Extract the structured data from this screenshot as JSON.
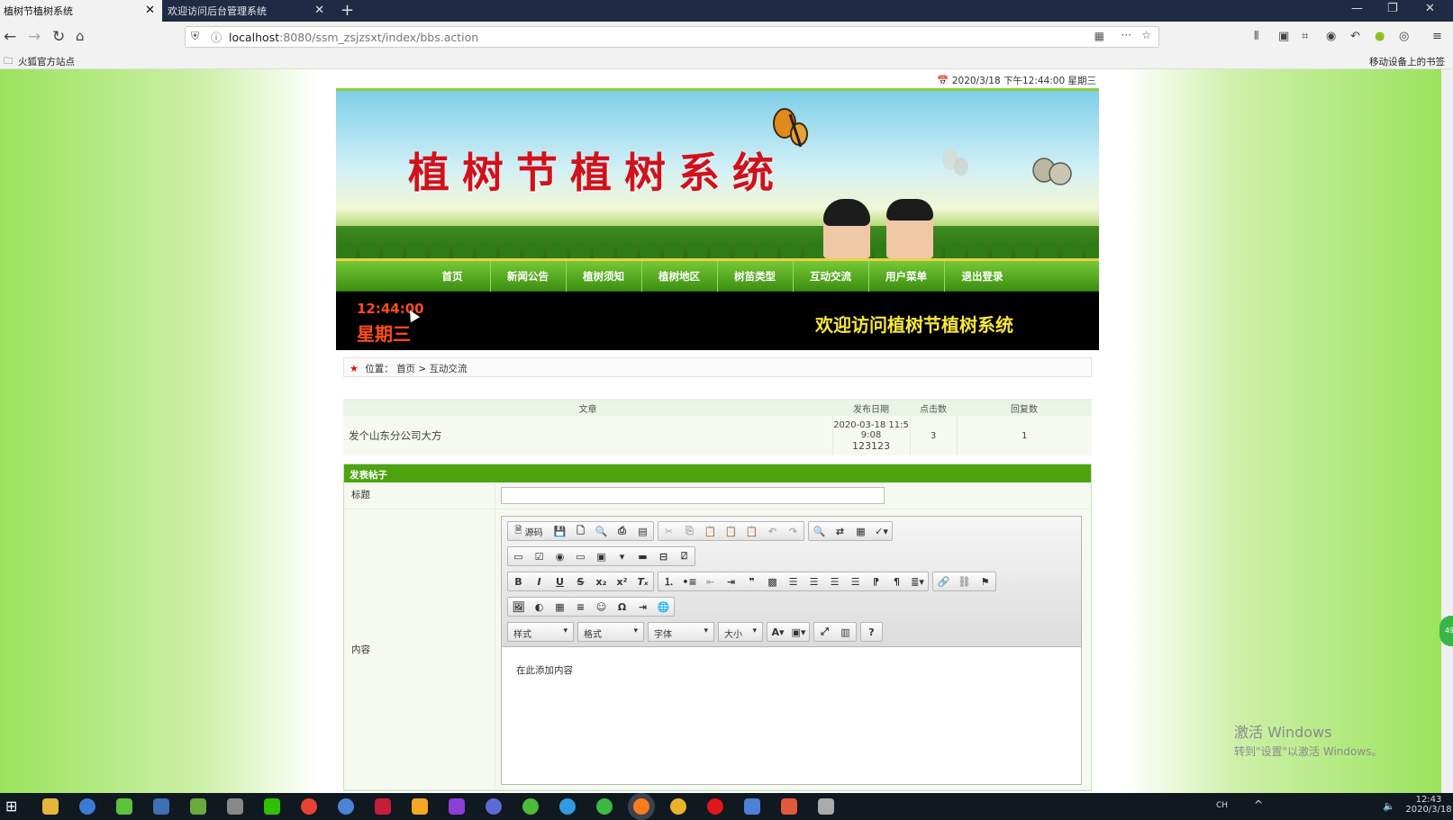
{
  "browser": {
    "tabs": [
      {
        "label": "植树节植树系统",
        "active": true
      },
      {
        "label": "欢迎访问后台管理系统",
        "active": false
      }
    ],
    "url_host": "localhost",
    "url_rest": ":8080/ssm_zsjzsxt/index/bbs.action",
    "bookmark_left": "火狐官方站点",
    "bookmark_right": "移动设备上的书签"
  },
  "site": {
    "datetime": "2020/3/18 下午12:44:00 星期三",
    "banner_title": "植树节植树系统",
    "menu": [
      "首页",
      "新闻公告",
      "植树须知",
      "植树地区",
      "树苗类型",
      "互动交流",
      "用户菜单",
      "退出登录"
    ],
    "clock_time": "12:44:00",
    "clock_week": "星期三",
    "welcome": "欢迎访问植树节植树系统",
    "breadcrumb": {
      "prefix": "位置：",
      "home": "首页",
      "sep": ">",
      "current": "互动交流"
    }
  },
  "posts": {
    "headers": [
      "文章",
      "发布日期",
      "点击数",
      "回复数"
    ],
    "rows": [
      {
        "subject": "发个山东分公司大方",
        "date_line1": "2020-03-18 11:5",
        "date_line2": "9:08",
        "date_line3": "123123",
        "clicks": "3",
        "replies": "1"
      }
    ]
  },
  "form": {
    "header": "发表帖子",
    "title_label": "标题",
    "content_label": "内容",
    "editor": {
      "source_label": "源码",
      "style_combo": "样式",
      "format_combo": "格式",
      "font_combo": "字体",
      "size_combo": "大小",
      "placeholder": "在此添加内容"
    }
  },
  "watermark": {
    "line1": "激活 Windows",
    "line2": "转到\"设置\"以激活 Windows。"
  },
  "taskbar": {
    "time": "12:43",
    "date": "2020/3/18"
  },
  "colors": {
    "menu_green": "#4ca40f",
    "clock_red": "#ff4d1a",
    "welcome_yellow": "#f7e63a",
    "title_red": "#d1111b"
  }
}
